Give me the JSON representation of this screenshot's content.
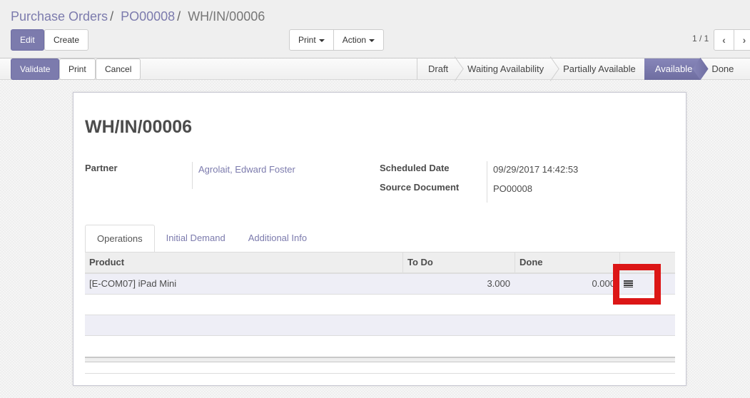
{
  "breadcrumb": {
    "items": [
      "Purchase Orders",
      "PO00008"
    ],
    "current": "WH/IN/00006",
    "separator": "/"
  },
  "control_panel": {
    "edit_label": "Edit",
    "create_label": "Create",
    "print_label": "Print",
    "action_label": "Action",
    "pager_value": "1 / 1",
    "pager_prev": "‹",
    "pager_next": "›"
  },
  "header": {
    "validate_label": "Validate",
    "print_label": "Print",
    "cancel_label": "Cancel",
    "stages": [
      "Draft",
      "Waiting Availability",
      "Partially Available",
      "Available",
      "Done"
    ],
    "active_stage": "Available"
  },
  "form": {
    "title": "WH/IN/00006",
    "partner_label": "Partner",
    "partner_value": "Agrolait, Edward Foster",
    "scheduled_date_label": "Scheduled Date",
    "scheduled_date_value": "09/29/2017 14:42:53",
    "source_document_label": "Source Document",
    "source_document_value": "PO00008"
  },
  "tabs": [
    {
      "label": "Operations",
      "active": true
    },
    {
      "label": "Initial Demand",
      "active": false
    },
    {
      "label": "Additional Info",
      "active": false
    }
  ],
  "operations_table": {
    "columns": [
      "Product",
      "To Do",
      "Done",
      ""
    ],
    "rows": [
      {
        "product": "[E-COM07] iPad Mini",
        "todo": "3.000",
        "done": "0.000",
        "action_icon": "list-icon"
      }
    ]
  },
  "colors": {
    "accent": "#7c7bad",
    "highlight": "#dc1616"
  }
}
